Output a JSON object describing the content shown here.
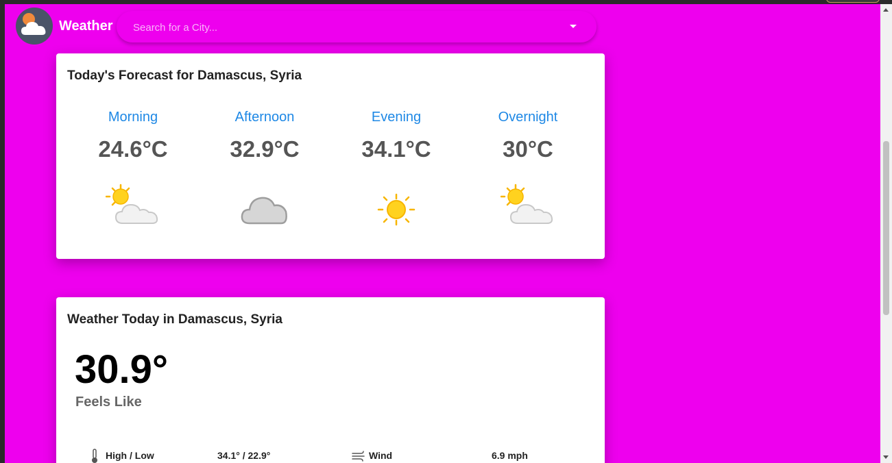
{
  "app": {
    "title": "Weather",
    "logo_icon": "partly-cloudy-icon"
  },
  "search": {
    "placeholder": "Search for a City..."
  },
  "forecast": {
    "title": "Today's Forecast for Damascus, Syria",
    "periods": [
      {
        "name": "Morning",
        "temp": "24.6°C",
        "icon": "partly-cloudy-icon"
      },
      {
        "name": "Afternoon",
        "temp": "32.9°C",
        "icon": "cloud-icon"
      },
      {
        "name": "Evening",
        "temp": "34.1°C",
        "icon": "sun-icon"
      },
      {
        "name": "Overnight",
        "temp": "30°C",
        "icon": "partly-cloudy-icon"
      }
    ]
  },
  "today": {
    "title": "Weather Today in Damascus, Syria",
    "feels_like_temp": "30.9°",
    "feels_like_label": "Feels Like",
    "details": [
      {
        "icon": "thermometer-icon",
        "label": "High / Low",
        "value": "34.1° / 22.9°"
      },
      {
        "icon": "wind-icon",
        "label": "Wind",
        "value": "6.9 mph"
      }
    ]
  },
  "colors": {
    "background": "#ee00ee",
    "accent": "#1e88e5"
  }
}
